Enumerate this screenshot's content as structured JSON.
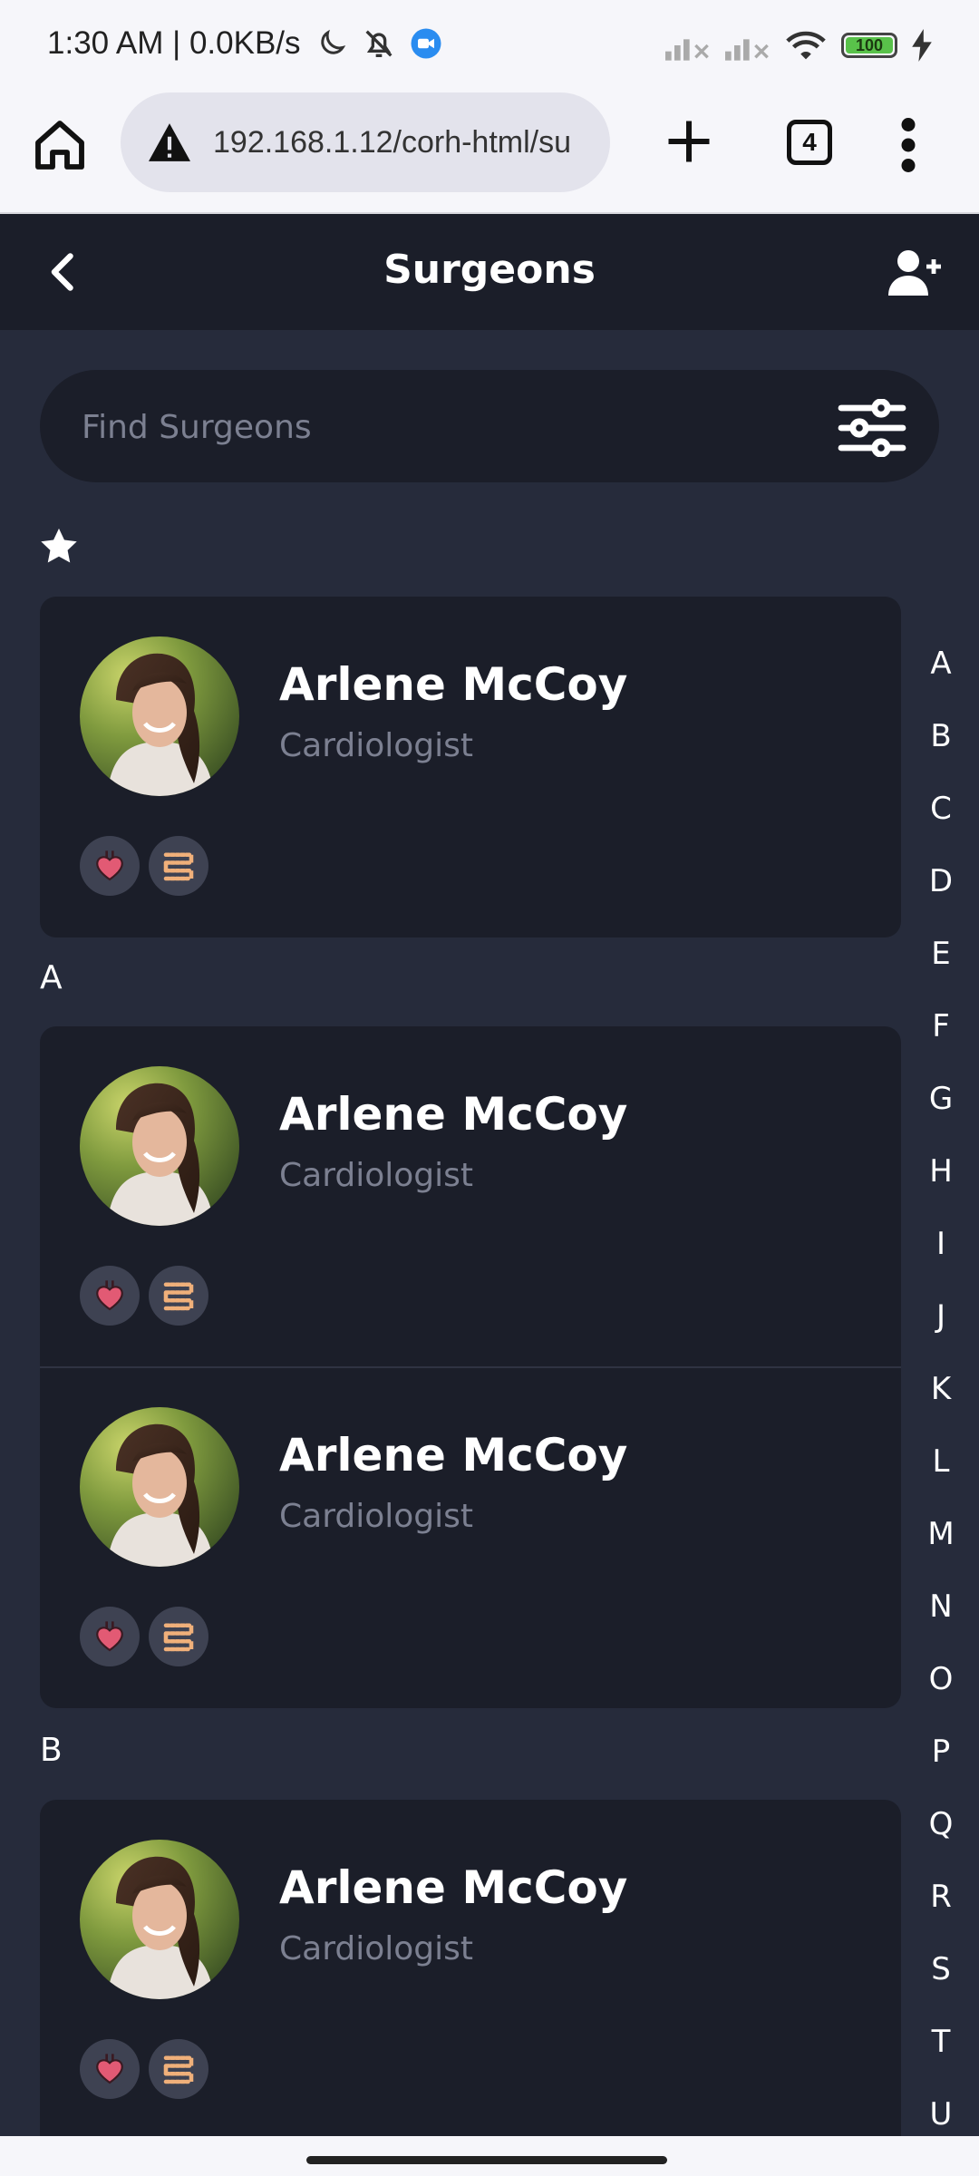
{
  "status_bar": {
    "time_speed": "1:30 AM | 0.0KB/s",
    "battery": "100"
  },
  "browser": {
    "url": "192.168.1.12/corh-html/su",
    "tab_count": "4"
  },
  "header": {
    "title": "Surgeons"
  },
  "search": {
    "placeholder": "Find Surgeons"
  },
  "favorites": [
    {
      "name": "Arlene McCoy",
      "specialty": "Cardiologist"
    }
  ],
  "sections": [
    {
      "letter": "A",
      "surgeons": [
        {
          "name": "Arlene McCoy",
          "specialty": "Cardiologist"
        },
        {
          "name": "Arlene McCoy",
          "specialty": "Cardiologist"
        }
      ]
    },
    {
      "letter": "B",
      "surgeons": [
        {
          "name": "Arlene McCoy",
          "specialty": "Cardiologist"
        }
      ]
    }
  ],
  "alphabet_index": [
    "A",
    "B",
    "C",
    "D",
    "E",
    "F",
    "G",
    "H",
    "I",
    "J",
    "K",
    "L",
    "M",
    "N",
    "O",
    "P",
    "Q",
    "R",
    "S",
    "T",
    "U"
  ],
  "icons": {
    "back": "chevron-left-icon",
    "add_user": "user-plus-icon",
    "filter": "sliders-icon",
    "favorite": "star-icon",
    "badge_1": "heart-organ-icon",
    "badge_2": "intestine-icon"
  },
  "colors": {
    "page_bg": "#262b3b",
    "card_bg": "#1b1e29",
    "muted_text": "#7c8091",
    "heart": "#e25a74",
    "intestine": "#f0b07a"
  }
}
